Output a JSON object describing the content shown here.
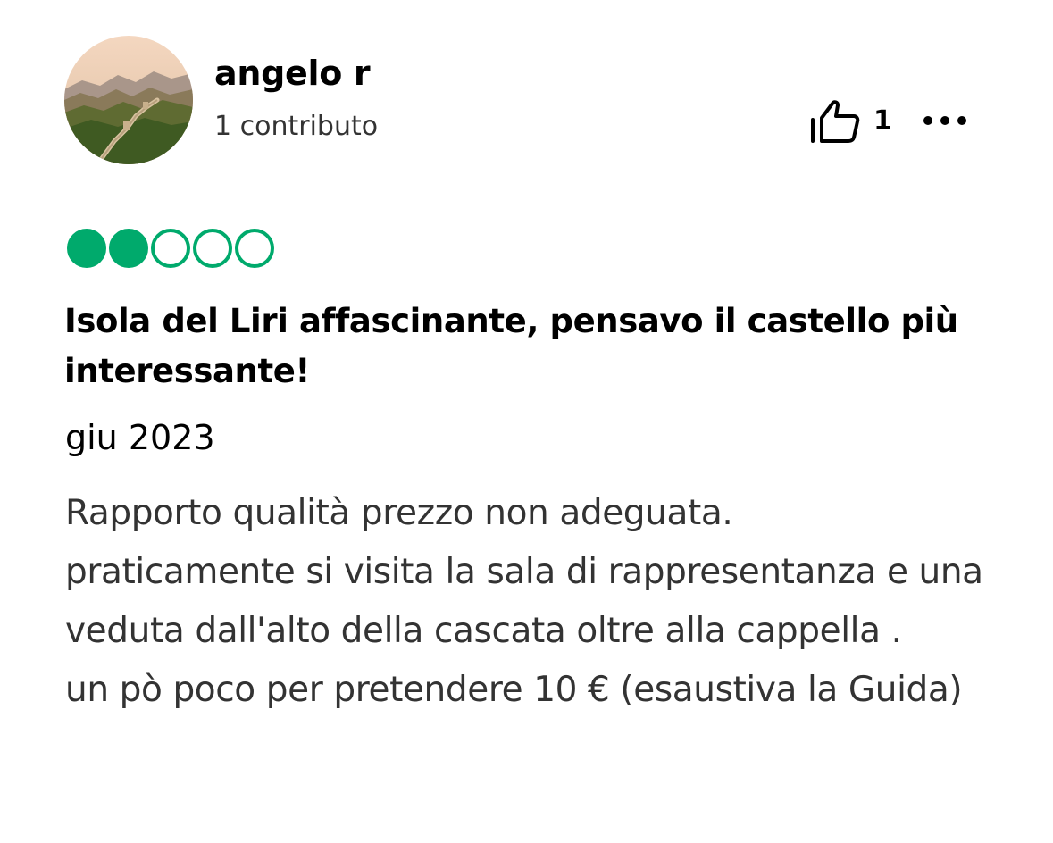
{
  "user": {
    "name": "angelo r",
    "contributions": "1 contributo"
  },
  "actions": {
    "helpful_icon": "thumbs-up-icon",
    "helpful_count": "1",
    "more_icon": "more-options-icon"
  },
  "rating": {
    "value": 2,
    "max": 5,
    "color": "#00aa6c"
  },
  "review": {
    "title": "Isola del Liri affascinante, pensavo il castello più interessante!",
    "date": "giu 2023",
    "body": "Rapporto qualità prezzo non adeguata.\npraticamente si visita la sala di rappresentanza e una veduta dall'alto della cascata oltre alla cappella .\nun pò poco per pretendere 10 € (esaustiva la Guida)"
  }
}
